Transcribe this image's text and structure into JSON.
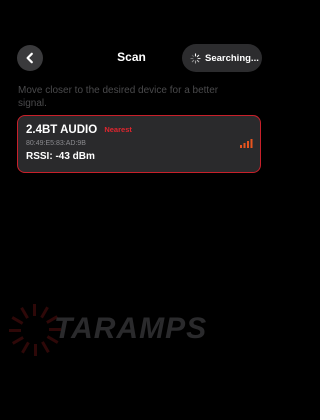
{
  "header": {
    "back_icon": "chevron-left-icon",
    "title": "Scan",
    "search_status": "Searching...",
    "spinner_icon": "spinner-icon"
  },
  "hint": "Move closer to the desired device for a better signal.",
  "devices": [
    {
      "name": "2.4BT AUDIO",
      "badge": "Nearest",
      "mac": "80:49:E5:83:AD:9B",
      "rssi_text": "RSSI: -43 dBm",
      "signal_icon": "signal-bars-icon"
    }
  ],
  "watermark": {
    "text": "TARAMPS"
  },
  "colors": {
    "background": "#000000",
    "accent": "#e0262f",
    "card_background": "#2a2a2c",
    "pill_background": "#2c2c2e",
    "hint_text": "#4a4a4c",
    "signal": "#e8541e"
  }
}
